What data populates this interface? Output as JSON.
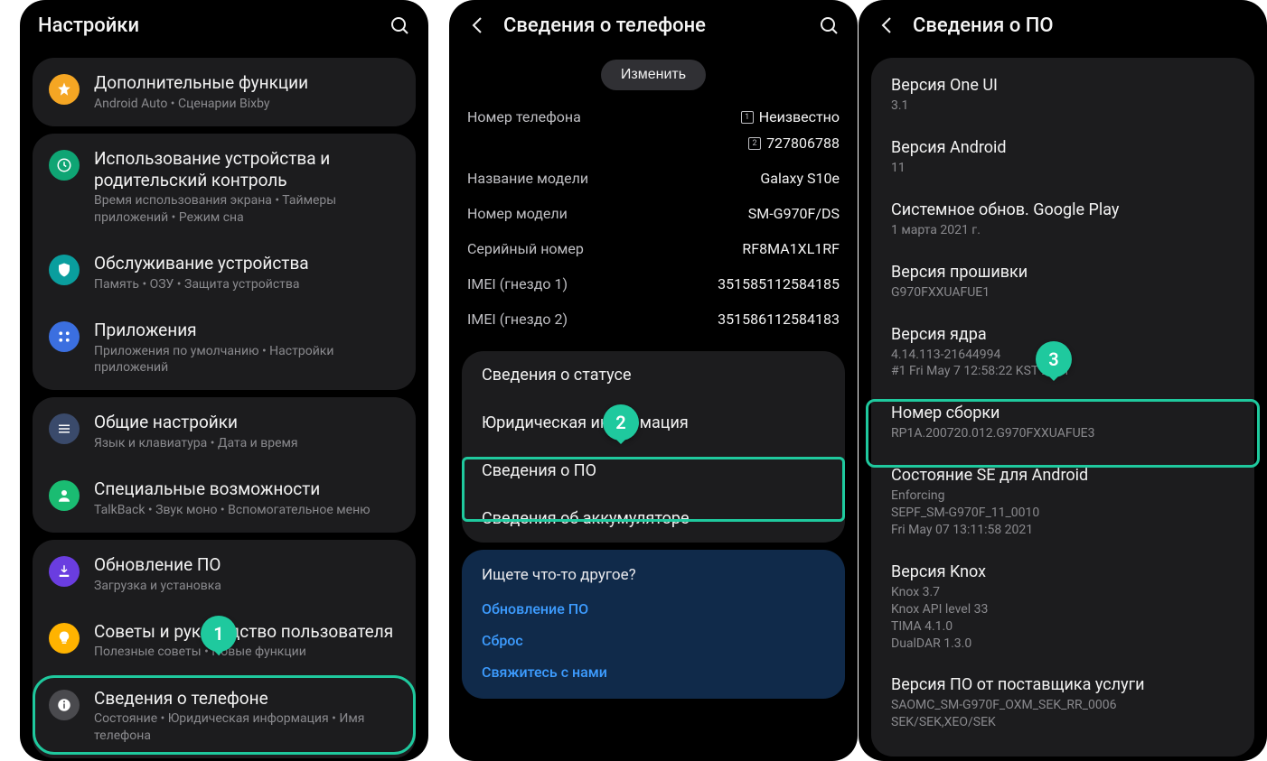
{
  "markers": {
    "m1": "1",
    "m2": "2",
    "m3": "3"
  },
  "screen1": {
    "header_title": "Настройки",
    "groups": [
      {
        "items": [
          {
            "icon": "ic-orange",
            "glyph": "star",
            "title": "Дополнительные функции",
            "sub": "Android Auto  •  Сценарии Bixby"
          }
        ]
      },
      {
        "items": [
          {
            "icon": "ic-green",
            "glyph": "clock",
            "title": "Использование устройства и родительский контроль",
            "sub": "Время использования экрана  •  Таймеры приложений  •  Режим сна"
          },
          {
            "icon": "ic-teal",
            "glyph": "shield",
            "title": "Обслуживание устройства",
            "sub": "Память  •  ОЗУ  •  Защита устройства"
          },
          {
            "icon": "ic-blue",
            "glyph": "grid",
            "title": "Приложения",
            "sub": "Приложения по умолчанию  •  Настройки приложений"
          }
        ]
      },
      {
        "items": [
          {
            "icon": "ic-darkblue",
            "glyph": "sliders",
            "title": "Общие настройки",
            "sub": "Язык и клавиатура  •  Дата и время"
          },
          {
            "icon": "ic-emerald",
            "glyph": "person",
            "title": "Специальные возможности",
            "sub": "TalkBack  •  Звук моно  •  Вспомогательное меню"
          }
        ]
      },
      {
        "items": [
          {
            "icon": "ic-purple",
            "glyph": "download",
            "title": "Обновление ПО",
            "sub": "Загрузка и установка"
          },
          {
            "icon": "ic-amber",
            "glyph": "bulb",
            "title": "Советы и руководство пользователя",
            "sub": "Полезные советы  •  Новые функции"
          },
          {
            "icon": "ic-grey",
            "glyph": "info",
            "title": "Сведения о телефоне",
            "sub": "Состояние  •  Юридическая информация  •  Имя телефона"
          }
        ]
      }
    ]
  },
  "screen2": {
    "header_title": "Сведения о телефоне",
    "edit_btn": "Изменить",
    "details": {
      "phone_label": "Номер телефона",
      "phone_v1": "Неизвестно",
      "phone_v2": "727806788",
      "model_name_label": "Название модели",
      "model_name": "Galaxy S10e",
      "model_num_label": "Номер модели",
      "model_num": "SM-G970F/DS",
      "serial_label": "Серийный номер",
      "serial": "RF8MA1XL1RF",
      "imei1_label": "IMEI (гнездо 1)",
      "imei1": "351585112584185",
      "imei2_label": "IMEI (гнездо 2)",
      "imei2": "351586112584183"
    },
    "links": {
      "status": "Сведения о статусе",
      "legal": "Юридическая информация",
      "software": "Сведения о ПО",
      "battery": "Сведения об аккумуляторе"
    },
    "suggest": {
      "title": "Ищете что-то другое?",
      "l1": "Обновление ПО",
      "l2": "Сброс",
      "l3": "Свяжитесь с нами"
    }
  },
  "screen3": {
    "header_title": "Сведения о ПО",
    "items": [
      {
        "title": "Версия One UI",
        "val": "3.1"
      },
      {
        "title": "Версия Android",
        "val": "11"
      },
      {
        "title": "Системное обнов. Google Play",
        "val": "1 марта 2021 г."
      },
      {
        "title": "Версия прошивки",
        "val": "G970FXXUAFUE1"
      },
      {
        "title": "Версия ядра",
        "val": "4.14.113-21644994\n#1 Fri May 7 12:58:22 KST 2021"
      },
      {
        "title": "Номер сборки",
        "val": "RP1A.200720.012.G970FXXUAFUE3"
      },
      {
        "title": "Состояние SE для Android",
        "val": "Enforcing\nSEPF_SM-G970F_11_0010\nFri May 07 13:11:58 2021"
      },
      {
        "title": "Версия Knox",
        "val": "Knox 3.7\nKnox API level 33\nTIMA 4.1.0\nDualDAR 1.3.0"
      },
      {
        "title": "Версия ПО от поставщика услуги",
        "val": "SAOMC_SM-G970F_OXM_SEK_RR_0006\nSEK/SEK,XEO/SEK"
      }
    ]
  }
}
